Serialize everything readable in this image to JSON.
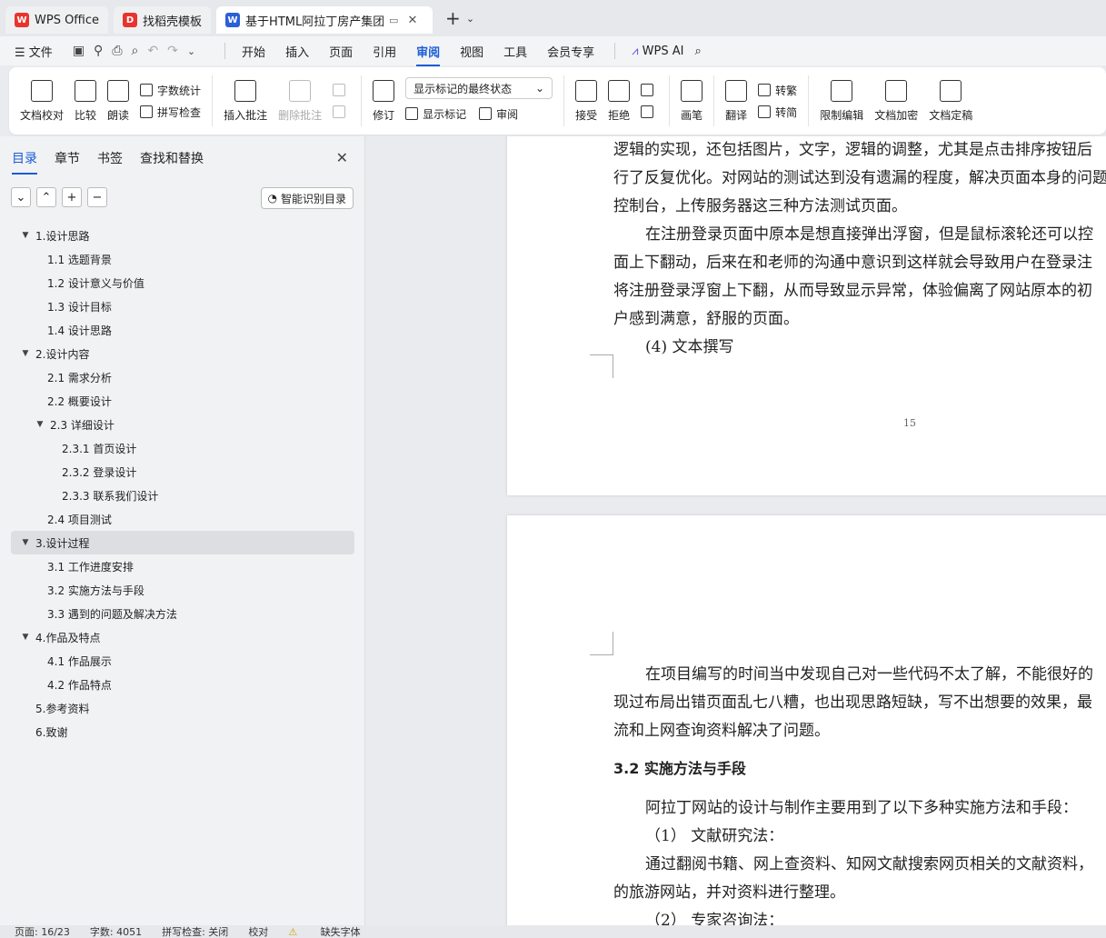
{
  "tabs": [
    {
      "label": "WPS Office",
      "icon": "wps-logo-icon",
      "color": "#e8342e",
      "active": false
    },
    {
      "label": "找稻壳模板",
      "icon": "docer-icon",
      "color": "#e8342e",
      "active": false
    },
    {
      "label": "基于HTML阿拉丁房产集团的网",
      "icon": "word-doc-icon",
      "color": "#2b5fd9",
      "active": true
    }
  ],
  "menu": {
    "file": "文件",
    "items": [
      "开始",
      "插入",
      "页面",
      "引用",
      "审阅",
      "视图",
      "工具",
      "会员专享"
    ],
    "active": "审阅",
    "ai": "WPS AI"
  },
  "ribbon": {
    "doc_check": "文档校对",
    "compare": "比较",
    "read_aloud": "朗读",
    "word_count": "字数统计",
    "spell_check": "拼写检查",
    "insert_comment": "插入批注",
    "delete_comment": "删除批注",
    "track": "修订",
    "markup_state": "显示标记的最终状态",
    "show_markup": "显示标记",
    "review": "审阅",
    "accept": "接受",
    "reject": "拒绝",
    "pen": "画笔",
    "translate": "翻译",
    "to_traditional": "转繁",
    "to_simplified": "转简",
    "restrict_edit": "限制编辑",
    "encrypt": "文档加密",
    "finalize": "文档定稿"
  },
  "nav": {
    "tabs": [
      "目录",
      "章节",
      "书签",
      "查找和替换"
    ],
    "active_tab": "目录",
    "smart_toc": "智能识别目录",
    "toc": [
      {
        "label": "1.设计思路",
        "level": 1,
        "expand": true
      },
      {
        "label": "1.1 选题背景",
        "level": 2
      },
      {
        "label": "1.2 设计意义与价值",
        "level": 2
      },
      {
        "label": "1.3 设计目标",
        "level": 2
      },
      {
        "label": "1.4 设计思路",
        "level": 2
      },
      {
        "label": "2.设计内容",
        "level": 1,
        "expand": true
      },
      {
        "label": "2.1 需求分析",
        "level": 2
      },
      {
        "label": "2.2 概要设计",
        "level": 2
      },
      {
        "label": "2.3 详细设计",
        "level": 2,
        "expand": true
      },
      {
        "label": "2.3.1 首页设计",
        "level": 3
      },
      {
        "label": "2.3.2 登录设计",
        "level": 3
      },
      {
        "label": "2.3.3 联系我们设计",
        "level": 3
      },
      {
        "label": "2.4 项目测试",
        "level": 2
      },
      {
        "label": "3.设计过程",
        "level": 1,
        "expand": true,
        "selected": true
      },
      {
        "label": "3.1 工作进度安排",
        "level": 2
      },
      {
        "label": "3.2 实施方法与手段",
        "level": 2
      },
      {
        "label": "3.3 遇到的问题及解决方法",
        "level": 2
      },
      {
        "label": "4.作品及特点",
        "level": 1,
        "expand": true
      },
      {
        "label": "4.1 作品展示",
        "level": 2
      },
      {
        "label": "4.2 作品特点",
        "level": 2
      },
      {
        "label": "5.参考资料",
        "level": 1
      },
      {
        "label": "6.致谢",
        "level": 1
      }
    ]
  },
  "doc": {
    "page1_lines": [
      "逻辑的实现，还包括图片，文字，逻辑的调整，尤其是点击排序按钮后",
      "行了反复优化。对网站的测试达到没有遗漏的程度，解决页面本身的问题",
      "控制台，上传服务器这三种方法测试页面。",
      "在注册登录页面中原本是想直接弹出浮窗，但是鼠标滚轮还可以控",
      "面上下翻动，后来在和老师的沟通中意识到这样就会导致用户在登录注",
      "将注册登录浮窗上下翻，从而导致显示异常，体验偏离了网站原本的初",
      "户感到满意，舒服的页面。",
      "(4)  文本撰写"
    ],
    "page_number": "15",
    "page2_lines": [
      "在项目编写的时间当中发现自己对一些代码不太了解，不能很好的",
      "现过布局出错页面乱七八糟，也出现思路短缺，写不出想要的效果，最",
      "流和上网查询资料解决了问题。"
    ],
    "heading": "3.2 实施方法与手段",
    "page2_more": [
      "阿拉丁网站的设计与制作主要用到了以下多种实施方法和手段：",
      "（1）  文献研究法：",
      "通过翻阅书籍、网上查资料、知网文献搜索网页相关的文献资料，",
      "的旅游网站，并对资料进行整理。",
      "（2）  专家咨询法："
    ]
  },
  "status": {
    "page": "页面: 16/23",
    "words": "字数: 4051",
    "spell": "拼写检查: 关闭",
    "proof": "校对",
    "missing_font": "缺失字体"
  }
}
